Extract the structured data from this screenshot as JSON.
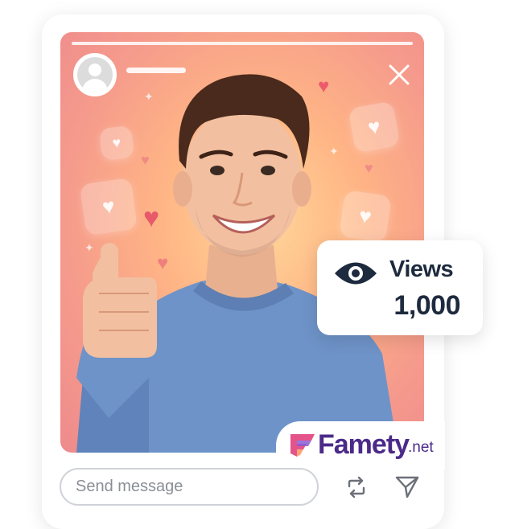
{
  "views": {
    "icon": "eye-icon",
    "label": "Views",
    "count": "1,000"
  },
  "brand": {
    "logo_icon": "famety-logo-icon",
    "name": "Famety",
    "tld": ".net",
    "color": "#4b2a8a"
  },
  "composer": {
    "placeholder": "Send message",
    "repost_icon": "repost-icon",
    "send_icon": "send-icon"
  },
  "story": {
    "avatar_icon": "user-avatar-icon",
    "close_icon": "close-icon",
    "decor_icon": "heart-icon"
  },
  "colors": {
    "text_dark": "#1e2a3e",
    "heart": "#ec5b6b",
    "bg_gradient_center": "#ffd79a",
    "bg_gradient_edge": "#ee8a8c"
  }
}
